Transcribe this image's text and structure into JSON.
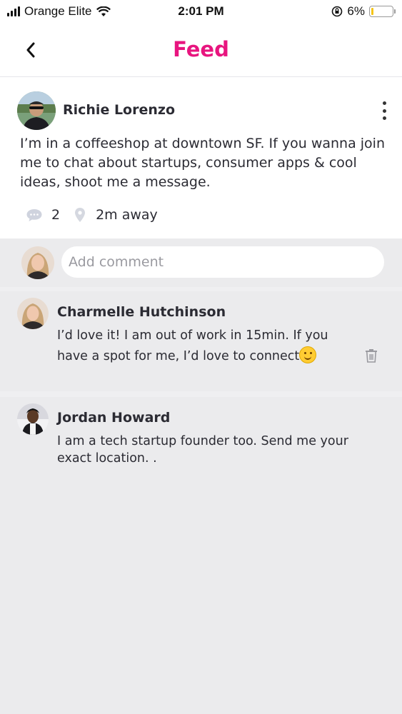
{
  "status_bar": {
    "carrier": "Orange Elite",
    "time": "2:01 PM",
    "battery": "6%",
    "battery_level": 0.06,
    "battery_color": "#f5c518"
  },
  "nav": {
    "title": "Feed",
    "title_color": "#e8157f",
    "back_icon": "chevron-left-icon"
  },
  "post": {
    "author": "Richie Lorenzo",
    "body": "I’m in a coffeeshop at downtown SF. If you wanna join me to chat about startups, consumer apps & cool ideas, shoot me a message.",
    "comment_count": "2",
    "distance": "2m away",
    "menu_icon": "more-vertical-icon"
  },
  "add_comment": {
    "placeholder": "Add comment"
  },
  "comments": [
    {
      "author": "Charmelle Hutchinson",
      "text": "I’d love it! I am out of work in 15min.  If you have a spot for me, I’d love to connect",
      "emoji": "smiling-emoji",
      "delete_icon": "trash-icon"
    },
    {
      "author": "Jordan Howard",
      "text": "I am a tech startup founder too. Send me your exact location. ."
    }
  ]
}
